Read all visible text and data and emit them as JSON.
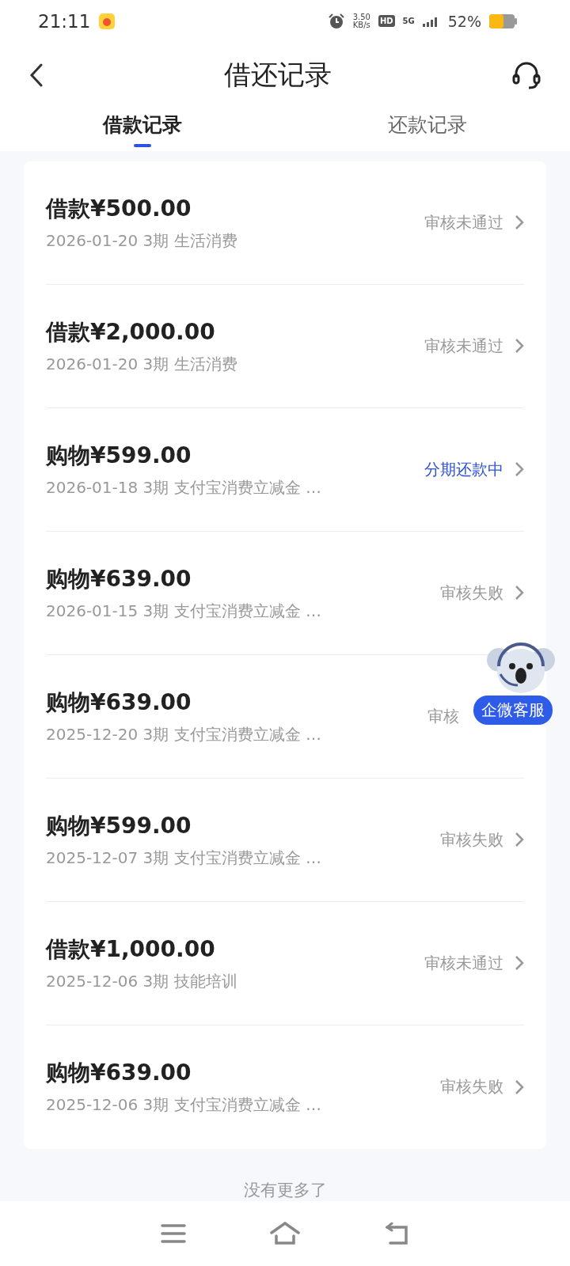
{
  "status_bar": {
    "time": "21:11",
    "speed_value": "3.50",
    "speed_unit": "KB/s",
    "hd": "HD",
    "network": "5G",
    "battery": "52%"
  },
  "header": {
    "title": "借还记录"
  },
  "tabs": [
    {
      "label": "借款记录",
      "selected": true
    },
    {
      "label": "还款记录",
      "selected": false
    }
  ],
  "records": [
    {
      "title": "借款¥500.00",
      "date": "2026-01-20",
      "term": "3期",
      "purpose": "生活消费",
      "status": "审核未通过",
      "kind": "done"
    },
    {
      "title": "借款¥2,000.00",
      "date": "2026-01-20",
      "term": "3期",
      "purpose": "生活消费",
      "status": "审核未通过",
      "kind": "done"
    },
    {
      "title": "购物¥599.00",
      "date": "2026-01-18",
      "term": "3期",
      "purpose": "支付宝消费立减金 …",
      "status": "分期还款中",
      "kind": "active"
    },
    {
      "title": "购物¥639.00",
      "date": "2026-01-15",
      "term": "3期",
      "purpose": "支付宝消费立减金 …",
      "status": "审核失败",
      "kind": "done"
    },
    {
      "title": "购物¥639.00",
      "date": "2025-12-20",
      "term": "3期",
      "purpose": "支付宝消费立减金 …",
      "status": "审核",
      "kind": "done",
      "chevron": false
    },
    {
      "title": "购物¥599.00",
      "date": "2025-12-07",
      "term": "3期",
      "purpose": "支付宝消费立减金 …",
      "status": "审核失败",
      "kind": "done"
    },
    {
      "title": "借款¥1,000.00",
      "date": "2025-12-06",
      "term": "3期",
      "purpose": "技能培训",
      "status": "审核未通过",
      "kind": "done"
    },
    {
      "title": "购物¥639.00",
      "date": "2025-12-06",
      "term": "3期",
      "purpose": "支付宝消费立减金 …",
      "status": "审核失败",
      "kind": "done"
    }
  ],
  "footer": {
    "text": "没有更多了"
  },
  "floating_service": {
    "label": "企微客服"
  }
}
